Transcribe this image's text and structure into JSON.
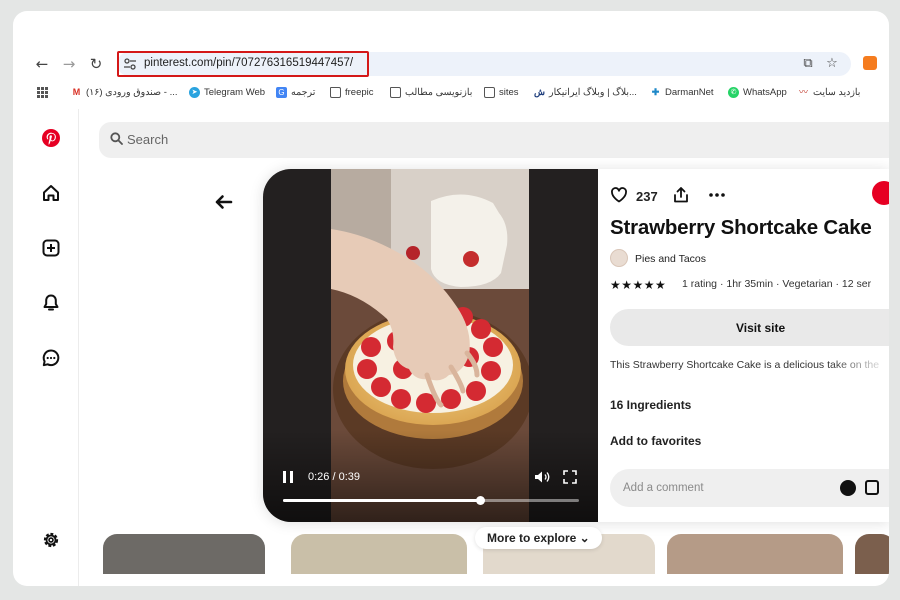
{
  "browser": {
    "url": "pinterest.com/pin/707276316519447457/",
    "icons": [
      "back-icon",
      "forward-icon",
      "reload-icon",
      "site-settings-icon",
      "install-app-icon",
      "star-icon",
      "extension-icon"
    ],
    "bookmarks": [
      {
        "label": "(۱۶) صندوق ورودی - ...",
        "icon": "gmail-icon"
      },
      {
        "label": "Telegram Web",
        "icon": "telegram-icon"
      },
      {
        "label": "ترجمه",
        "icon": "translate-icon"
      },
      {
        "label": "freepic",
        "icon": "folder-icon"
      },
      {
        "label": "بازنویسی مطالب",
        "icon": "folder-icon"
      },
      {
        "label": "sites",
        "icon": "folder-icon"
      },
      {
        "label": "بلاگ | وبلاگ ایرانیکار...",
        "icon": "site-icon"
      },
      {
        "label": "DarmanNet",
        "icon": "darmannet-icon"
      },
      {
        "label": "WhatsApp",
        "icon": "whatsapp-icon"
      },
      {
        "label": "بازدید سایت",
        "icon": "site-icon"
      }
    ]
  },
  "pinterest": {
    "search_placeholder": "Search",
    "sidebar_icons": [
      "pinterest-logo-icon",
      "home-icon",
      "create-icon",
      "notifications-icon",
      "messages-icon",
      "settings-icon"
    ],
    "pin": {
      "save_count": "237",
      "title": "Strawberry Shortcake Cake",
      "creator": "Pies and Tacos",
      "stars": "★★★★★",
      "rating_meta": "1 rating · 1hr 35min · Vegetarian · 12 ser",
      "visit_label": "Visit site",
      "description": "This Strawberry Shortcake Cake is a delicious take on the",
      "ingredients_label": "16 Ingredients",
      "favorites_label": "Add to favorites",
      "comment_placeholder": "Add a comment",
      "video": {
        "time": "0:26 / 0:39",
        "progress": 0.667
      }
    },
    "more_explore": "More to explore ⌄"
  },
  "colors": {
    "pinterest_red": "#e60023",
    "url_highlight": "#d41818",
    "omnibox": "#edf2fa"
  }
}
